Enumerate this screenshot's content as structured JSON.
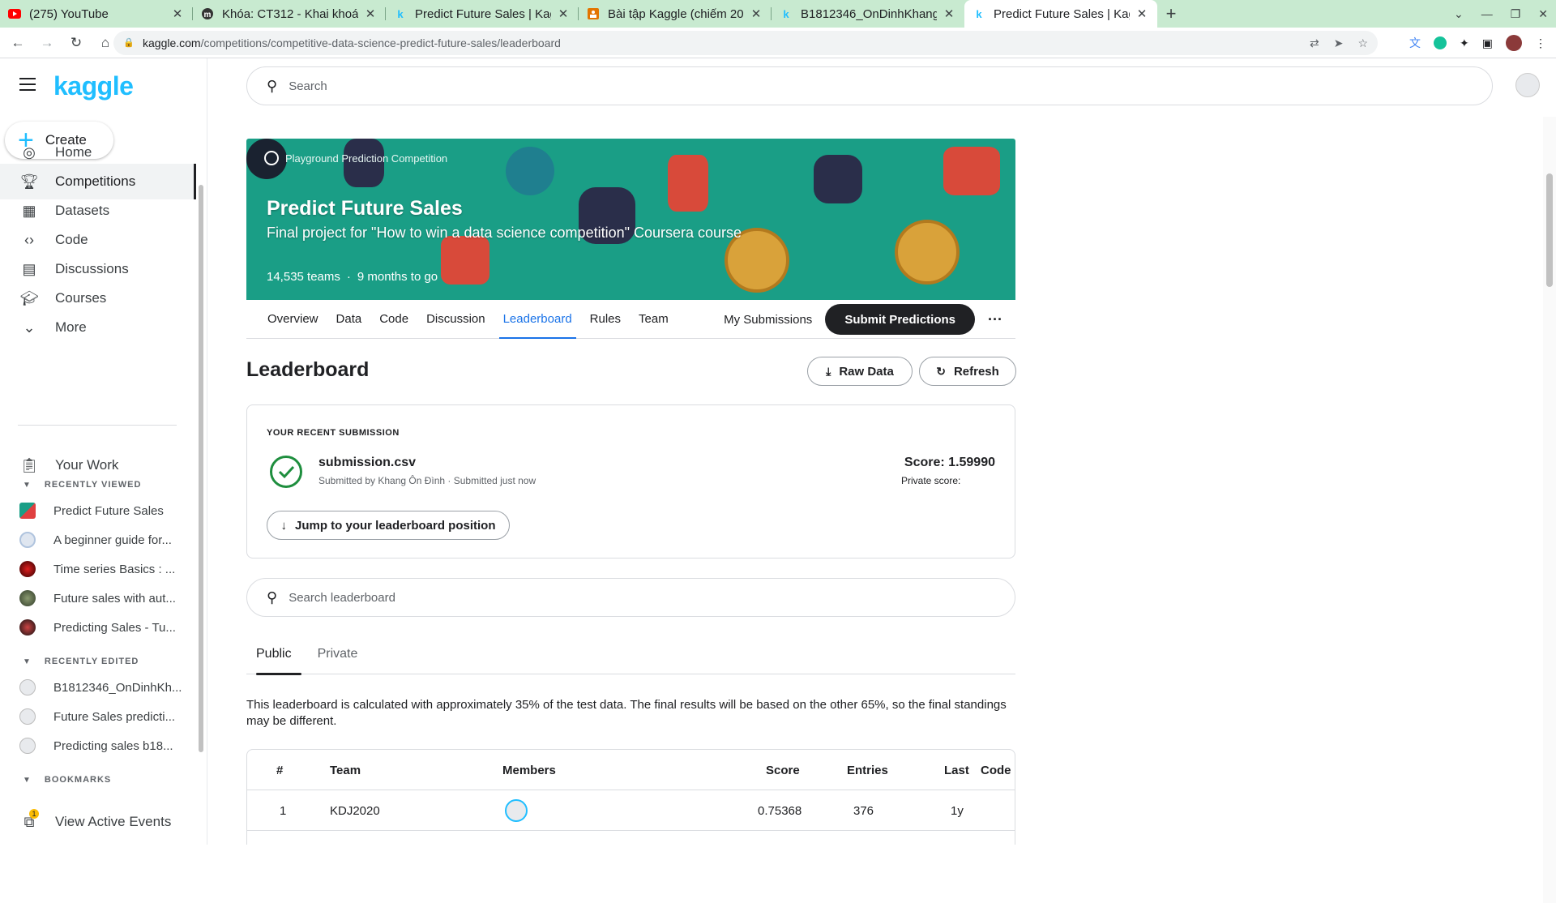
{
  "browser": {
    "tabs": [
      {
        "title": "(275) YouTube",
        "favicon": "youtube-icon"
      },
      {
        "title": "Khóa: CT312 - Khai khoán",
        "favicon": "moodle-icon"
      },
      {
        "title": "Predict Future Sales | Kag",
        "favicon": "kaggle-icon"
      },
      {
        "title": "Bài tập Kaggle (chiếm 20",
        "favicon": "doc-icon"
      },
      {
        "title": "B1812346_OnDinhKhang_",
        "favicon": "kaggle-icon"
      },
      {
        "title": "Predict Future Sales | Kag",
        "favicon": "kaggle-icon",
        "active": true
      }
    ],
    "url_host": "kaggle.com",
    "url_path": "/competitions/competitive-data-science-predict-future-sales/leaderboard"
  },
  "sidebar": {
    "logo": "kaggle",
    "create_label": "Create",
    "nav": [
      {
        "label": "Home",
        "icon": "compass-icon"
      },
      {
        "label": "Competitions",
        "icon": "trophy-icon",
        "selected": true
      },
      {
        "label": "Datasets",
        "icon": "table-icon"
      },
      {
        "label": "Code",
        "icon": "code-icon"
      },
      {
        "label": "Discussions",
        "icon": "discussion-icon"
      },
      {
        "label": "Courses",
        "icon": "courses-icon"
      },
      {
        "label": "More",
        "icon": "chevron-down-icon"
      }
    ],
    "your_work": "Your Work",
    "recently_viewed_heading": "RECENTLY VIEWED",
    "recently_viewed": [
      "Predict Future Sales",
      "A beginner guide for...",
      "Time series Basics : ...",
      "Future sales with aut...",
      "Predicting Sales - Tu..."
    ],
    "recently_edited_heading": "RECENTLY EDITED",
    "recently_edited": [
      "B1812346_OnDinhKh...",
      "Future Sales predicti...",
      "Predicting sales b18..."
    ],
    "bookmarks_heading": "BOOKMARKS",
    "view_active_events": "View Active Events",
    "events_badge": "1"
  },
  "search": {
    "placeholder": "Search"
  },
  "competition": {
    "tag": "Playground Prediction Competition",
    "title": "Predict Future Sales",
    "subtitle": "Final project for \"How to win a data science competition\" Coursera course",
    "teams": "14,535 teams",
    "time_left": "9 months to go",
    "tabs": [
      "Overview",
      "Data",
      "Code",
      "Discussion",
      "Leaderboard",
      "Rules",
      "Team"
    ],
    "active_tab": "Leaderboard",
    "my_submissions": "My Submissions",
    "submit_predictions": "Submit Predictions"
  },
  "leaderboard": {
    "title": "Leaderboard",
    "raw_data": "Raw Data",
    "refresh": "Refresh",
    "recent_label": "YOUR RECENT SUBMISSION",
    "file_name": "submission.csv",
    "submitted_by": "Submitted by Khang Ôn Đình · Submitted just now",
    "score": "Score: 1.59990",
    "private_score": "Private score:",
    "jump_label": "Jump to your leaderboard position",
    "search_placeholder": "Search leaderboard",
    "tab_public": "Public",
    "tab_private": "Private",
    "note": "This leaderboard is calculated with approximately 35% of the test data. The final results will be based on the other 65%, so the final standings may be different.",
    "columns": [
      "#",
      "Team",
      "Members",
      "Score",
      "Entries",
      "Last",
      "Code"
    ],
    "rows": [
      {
        "rank": "1",
        "team": "KDJ2020",
        "score": "0.75368",
        "entries": "376",
        "last": "1y"
      }
    ]
  }
}
